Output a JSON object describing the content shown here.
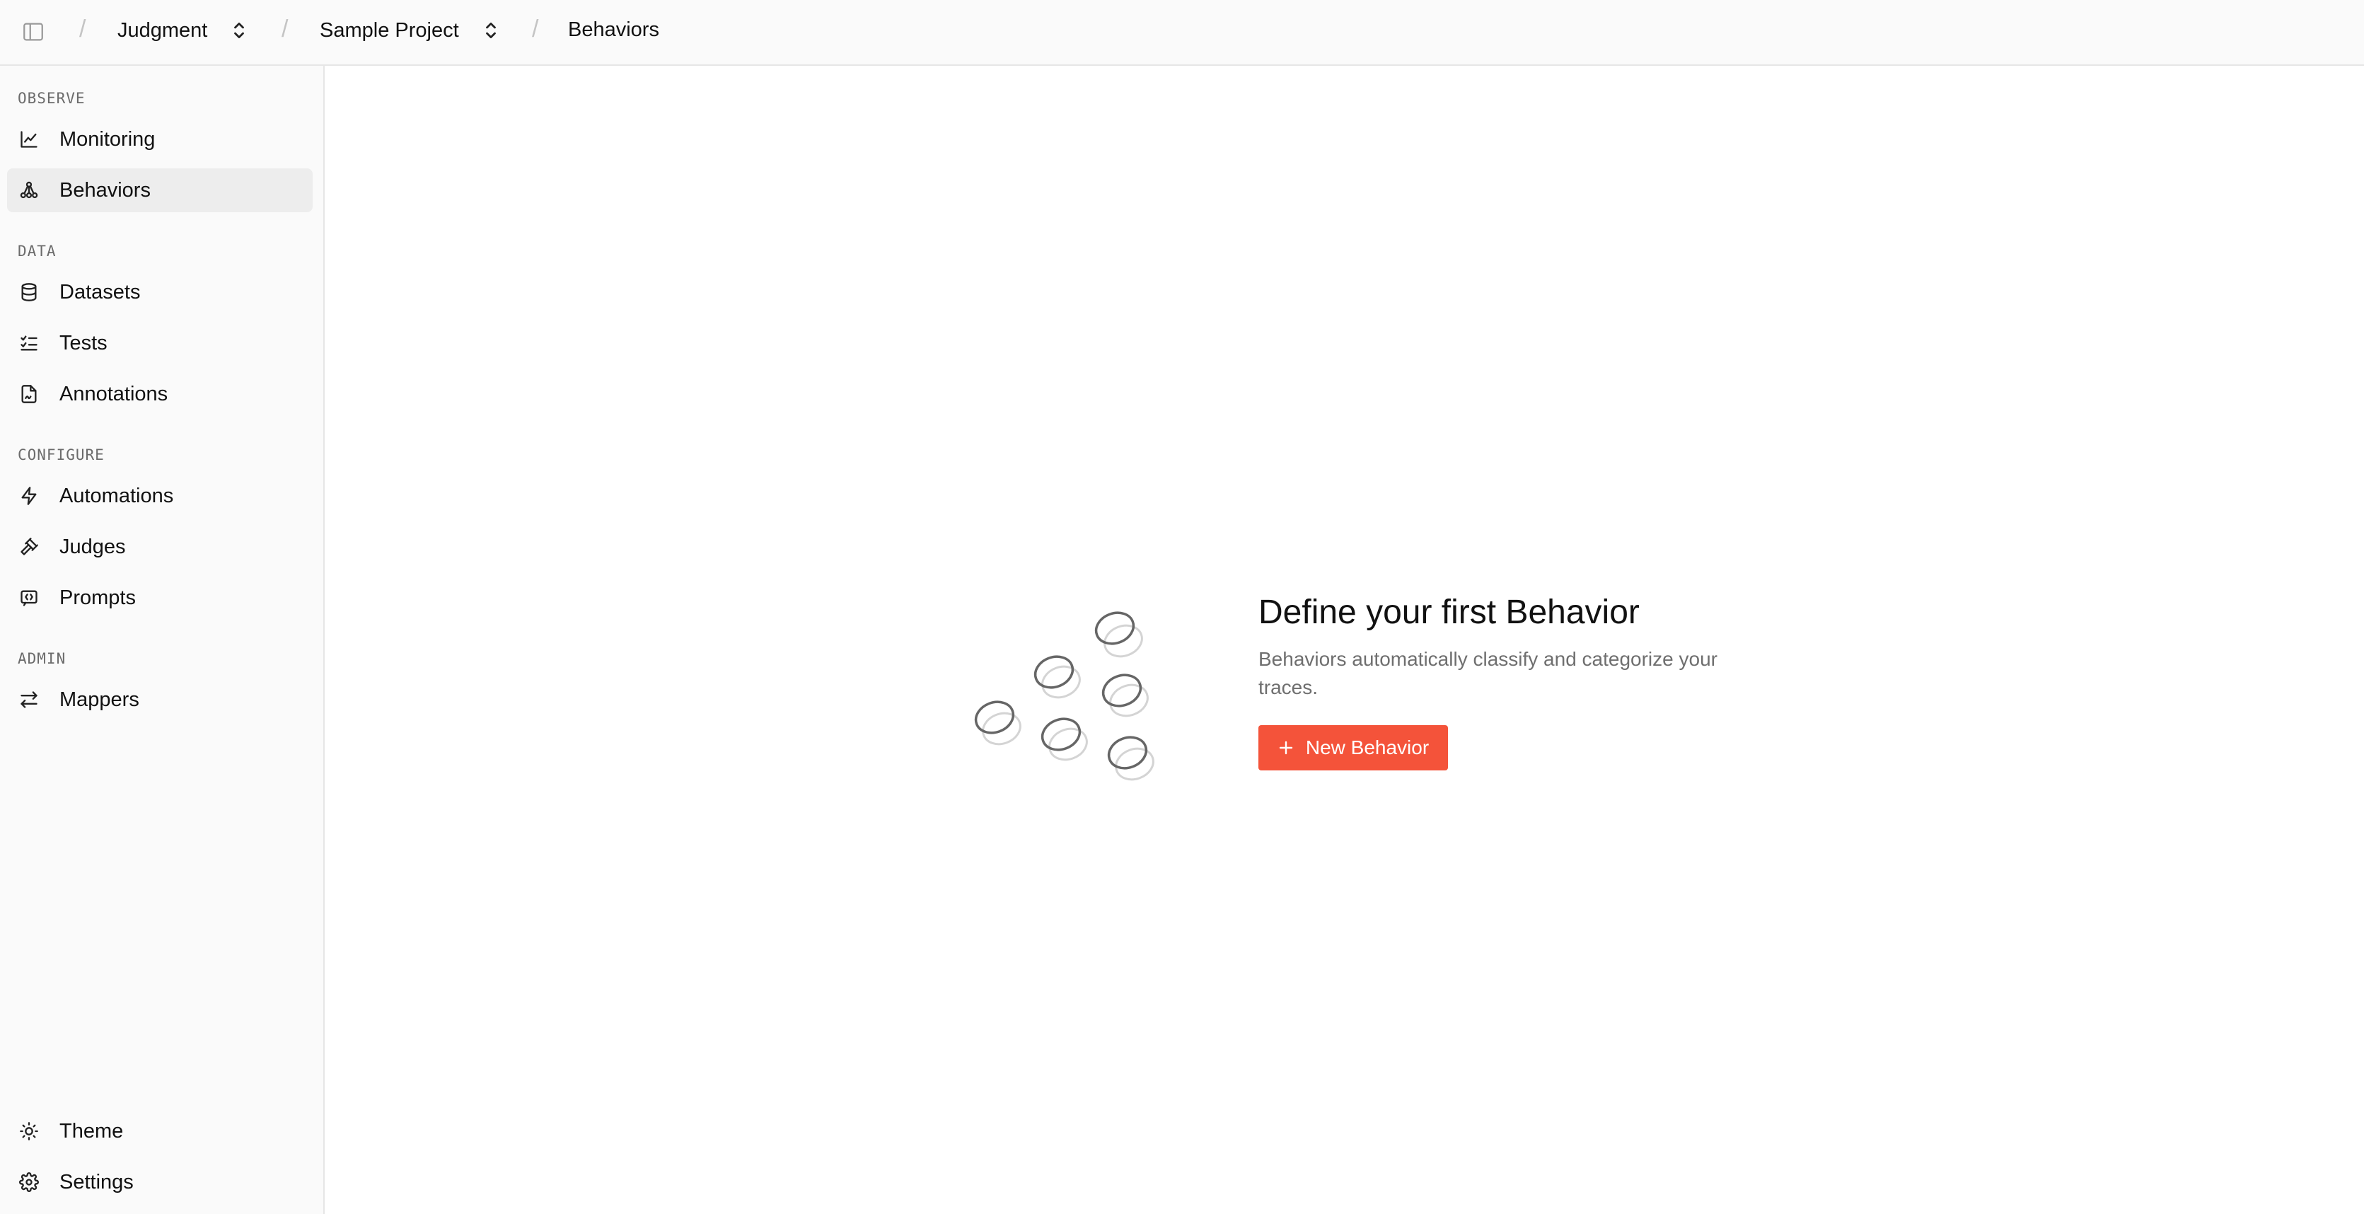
{
  "breadcrumb": {
    "separator": "/",
    "org": "Judgment",
    "project": "Sample Project",
    "page": "Behaviors"
  },
  "sidebar": {
    "sections": {
      "observe": "OBSERVE",
      "data": "DATA",
      "configure": "CONFIGURE",
      "admin": "ADMIN"
    },
    "items": {
      "monitoring": "Monitoring",
      "behaviors": "Behaviors",
      "datasets": "Datasets",
      "tests": "Tests",
      "annotations": "Annotations",
      "automations": "Automations",
      "judges": "Judges",
      "prompts": "Prompts",
      "mappers": "Mappers",
      "theme": "Theme",
      "settings": "Settings"
    },
    "active_item": "Behaviors"
  },
  "empty_state": {
    "title": "Define your first Behavior",
    "description": "Behaviors automatically classify and categorize your traces.",
    "button_label": "New Behavior"
  },
  "colors": {
    "accent": "#f4533a",
    "sidebar_bg": "#fafafa",
    "active_bg": "#ededed"
  },
  "icons": {
    "sidebar_toggle": "sidebar-toggle-icon",
    "chevron": "chevron-up-down-icon",
    "monitoring": "line-chart-icon",
    "behaviors": "network-nodes-icon",
    "datasets": "database-icon",
    "tests": "checklist-icon",
    "annotations": "file-signature-icon",
    "automations": "lightning-icon",
    "judges": "gavel-icon",
    "prompts": "code-square-icon",
    "mappers": "arrows-swap-icon",
    "theme": "sun-icon",
    "settings": "gear-icon",
    "new": "plus-icon"
  }
}
